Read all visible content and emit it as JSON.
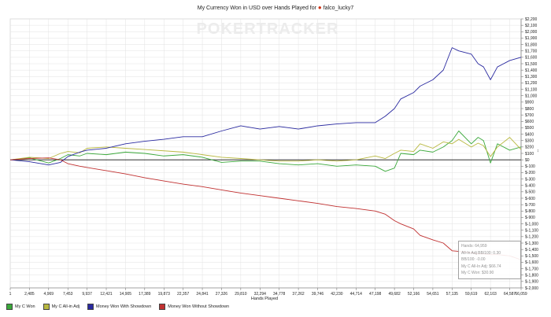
{
  "title": "My Currency Won in USD over Hands Played for",
  "player": "falco_lucky7",
  "watermark": "POKERTRACKER",
  "colors": {
    "c_won": "#3aa83a",
    "allin": "#b8b840",
    "showdown": "#2a2aa0",
    "noshowdown": "#c03030",
    "zero": "#111111",
    "grid": "#e2e2e2"
  },
  "chart_data": {
    "type": "line",
    "title": "My Currency Won in USD over Hands Played for falco_lucky7",
    "xlabel": "Hands Played",
    "ylabel": "",
    "xlim": [
      1,
      66059
    ],
    "ylim": [
      -2000,
      2200
    ],
    "x_ticks": [
      1,
      2485,
      4969,
      7453,
      9937,
      12421,
      14905,
      17389,
      19873,
      22357,
      24841,
      27326,
      29810,
      32294,
      34778,
      37262,
      39746,
      42230,
      44714,
      47198,
      49682,
      52166,
      54651,
      57135,
      59619,
      62103,
      64587,
      66059
    ],
    "x_tick_labels": [
      "1",
      "2,485",
      "4,969",
      "7,453",
      "9,937",
      "12,421",
      "14,905",
      "17,389",
      "19,873",
      "22,357",
      "24,841",
      "27,326",
      "29,810",
      "32,294",
      "34,778",
      "37,262",
      "39,746",
      "42,230",
      "44,714",
      "47,198",
      "49,682",
      "52,166",
      "54,651",
      "57,135",
      "59,619",
      "62,103",
      "64,587",
      "66,059"
    ],
    "y_ticks": [
      2200,
      2100,
      2000,
      1900,
      1800,
      1700,
      1600,
      1500,
      1400,
      1300,
      1200,
      1100,
      1000,
      900,
      800,
      700,
      600,
      500,
      400,
      300,
      200,
      100,
      0,
      -100,
      -200,
      -300,
      -400,
      -500,
      -600,
      -700,
      -800,
      -900,
      -1000,
      -1100,
      -1200,
      -1300,
      -1400,
      -1500,
      -1600,
      -1700,
      -1800,
      -1900,
      -2000
    ],
    "y_tick_labels": [
      "$2,200",
      "$2,100",
      "$2,000",
      "$1,900",
      "$1,800",
      "$1,700",
      "$1,600",
      "$1,500",
      "$1,400",
      "$1,300",
      "$1,200",
      "$1,100",
      "$1,000",
      "$900",
      "$800",
      "$700",
      "$600",
      "$500",
      "$400",
      "$300",
      "$200",
      "$100",
      "$0",
      "$-100",
      "$-200",
      "$-300",
      "$-400",
      "$-500",
      "$-600",
      "$-700",
      "$-800",
      "$-900",
      "$-1,000",
      "$-1,100",
      "$-1,200",
      "$-1,300",
      "$-1,400",
      "$-1,500",
      "$-1,600",
      "$-1,700",
      "$-1,800",
      "$-1,900",
      "$-2,000"
    ],
    "grid": true,
    "legend_position": "bottom-left",
    "series": [
      {
        "name": "My C Won",
        "color": "#3aa83a",
        "x": [
          1,
          2485,
          4969,
          6500,
          7453,
          9000,
          9937,
          12421,
          14905,
          17389,
          19873,
          22357,
          24841,
          27326,
          29810,
          32294,
          34778,
          37262,
          39746,
          42230,
          44714,
          47198,
          48500,
          49682,
          50500,
          52166,
          53000,
          54651,
          56000,
          57135,
          58000,
          59619,
          60500,
          61200,
          62103,
          63000,
          64587,
          66059
        ],
        "y": [
          0,
          30,
          -50,
          20,
          80,
          60,
          100,
          80,
          120,
          100,
          60,
          80,
          40,
          -40,
          -20,
          -20,
          -60,
          -80,
          -60,
          -100,
          -80,
          -100,
          -180,
          -130,
          100,
          80,
          150,
          120,
          200,
          300,
          450,
          250,
          350,
          300,
          -50,
          250,
          150,
          200
        ]
      },
      {
        "name": "My C All-in Adj",
        "color": "#b8b840",
        "x": [
          1,
          2485,
          4969,
          6500,
          7453,
          9000,
          9937,
          12421,
          14905,
          17389,
          19873,
          22357,
          24841,
          27326,
          29810,
          32294,
          34778,
          37262,
          39746,
          42230,
          44714,
          47198,
          48500,
          49682,
          50500,
          52166,
          53000,
          54651,
          56000,
          57135,
          58000,
          59619,
          60500,
          61200,
          62103,
          63000,
          64587,
          66059
        ],
        "y": [
          0,
          40,
          20,
          100,
          130,
          110,
          180,
          200,
          180,
          160,
          140,
          120,
          80,
          40,
          20,
          0,
          -20,
          -20,
          0,
          -20,
          0,
          60,
          20,
          100,
          150,
          130,
          250,
          180,
          280,
          250,
          320,
          200,
          260,
          220,
          50,
          200,
          350,
          160
        ]
      },
      {
        "name": "Money Won With Showdown",
        "color": "#2a2aa0",
        "x": [
          1,
          2485,
          4969,
          6500,
          7453,
          9000,
          9937,
          12421,
          14905,
          17389,
          19873,
          22357,
          24841,
          27326,
          29810,
          32294,
          34778,
          37262,
          39746,
          42230,
          44714,
          47198,
          48500,
          49682,
          50500,
          52166,
          53000,
          54651,
          56000,
          57135,
          58000,
          59619,
          60500,
          61200,
          62103,
          63000,
          64587,
          66059
        ],
        "y": [
          0,
          -30,
          -80,
          -40,
          50,
          120,
          150,
          180,
          250,
          290,
          320,
          360,
          360,
          450,
          530,
          480,
          520,
          480,
          530,
          560,
          580,
          580,
          680,
          800,
          950,
          1050,
          1150,
          1250,
          1400,
          1750,
          1700,
          1650,
          1500,
          1450,
          1250,
          1450,
          1550,
          1600
        ]
      },
      {
        "name": "Money Won Without Showdown",
        "color": "#c03030",
        "x": [
          1,
          2485,
          4969,
          6500,
          7453,
          9000,
          9937,
          12421,
          14905,
          17389,
          19873,
          22357,
          24841,
          27326,
          29810,
          32294,
          34778,
          37262,
          39746,
          42230,
          44714,
          47198,
          48500,
          49682,
          50500,
          52166,
          53000,
          54651,
          56000,
          57135,
          58000,
          59619,
          60500,
          61200,
          62103,
          63000,
          64587,
          66059
        ],
        "y": [
          0,
          20,
          30,
          0,
          -60,
          -100,
          -120,
          -170,
          -220,
          -280,
          -330,
          -380,
          -420,
          -470,
          -520,
          -560,
          -600,
          -640,
          -680,
          -730,
          -760,
          -800,
          -850,
          -950,
          -1000,
          -1080,
          -1180,
          -1250,
          -1300,
          -1420,
          -1430,
          -1450,
          -1470,
          -1470,
          -1480,
          -1480,
          -1500,
          -1560
        ]
      }
    ]
  },
  "tooltip": {
    "hands": "Hands: 64,959",
    "allin_adj_bb": "All-In Adj BB/100: 0.30",
    "bb100": "BB/100: -0.00",
    "allin_adj": "My C All-In Adj: $66.74",
    "c_won": "My C Won: $30.90"
  },
  "legend": [
    {
      "label": "My C Won",
      "color": "#3aa83a"
    },
    {
      "label": "My C All-in Adj",
      "color": "#b8b840"
    },
    {
      "label": "Money Won With Showdown",
      "color": "#2a2aa0"
    },
    {
      "label": "Money Won Without Showdown",
      "color": "#c03030"
    }
  ]
}
